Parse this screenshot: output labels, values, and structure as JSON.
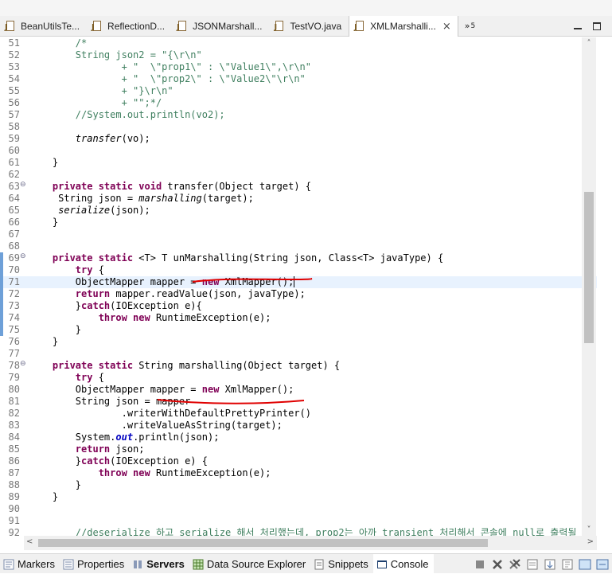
{
  "editor_tabs": [
    {
      "label": "BeanUtilsTe...",
      "icon": "java-file-icon",
      "active": false
    },
    {
      "label": "ReflectionD...",
      "icon": "java-file-icon",
      "active": false
    },
    {
      "label": "JSONMarshall...",
      "icon": "java-file-icon",
      "active": false
    },
    {
      "label": "TestVO.java",
      "icon": "java-file-icon",
      "active": false
    },
    {
      "label": "XMLMarshalli...",
      "icon": "java-file-icon",
      "active": true,
      "close": "×"
    }
  ],
  "overflow_tabs": {
    "symbol": "»",
    "count": "5"
  },
  "code_lines": [
    {
      "n": "51",
      "t": [
        [
          "cmt",
          "        /*"
        ]
      ]
    },
    {
      "n": "52",
      "t": [
        [
          "cmt",
          "        String json2 = \"{\\r\\n\""
        ]
      ]
    },
    {
      "n": "53",
      "t": [
        [
          "cmt",
          "                + \"  \\\"prop1\\\" : \\\"Value1\\\",\\r\\n\""
        ]
      ]
    },
    {
      "n": "54",
      "t": [
        [
          "cmt",
          "                + \"  \\\"prop2\\\" : \\\"Value2\\\"\\r\\n\""
        ]
      ]
    },
    {
      "n": "55",
      "t": [
        [
          "cmt",
          "                + \"}\\r\\n\""
        ]
      ]
    },
    {
      "n": "56",
      "t": [
        [
          "cmt",
          "                + \"\";*/"
        ]
      ]
    },
    {
      "n": "57",
      "t": [
        [
          "cmt",
          "        //System.out.println(vo2);"
        ]
      ]
    },
    {
      "n": "58",
      "t": []
    },
    {
      "n": "59",
      "t": [
        [
          "",
          "        "
        ],
        [
          "ital",
          "transfer"
        ],
        [
          "",
          "(vo);"
        ]
      ]
    },
    {
      "n": "60",
      "t": []
    },
    {
      "n": "61",
      "t": [
        [
          "",
          "    }"
        ]
      ]
    },
    {
      "n": "62",
      "t": []
    },
    {
      "n": "63",
      "fold": true,
      "t": [
        [
          "",
          "    "
        ],
        [
          "kw",
          "private static void"
        ],
        [
          "",
          " transfer(Object target) {"
        ]
      ]
    },
    {
      "n": "64",
      "t": [
        [
          "",
          "     String json = "
        ],
        [
          "ital",
          "marshalling"
        ],
        [
          "",
          "(target);"
        ]
      ]
    },
    {
      "n": "65",
      "t": [
        [
          "",
          "     "
        ],
        [
          "ital",
          "serialize"
        ],
        [
          "",
          "(json);"
        ]
      ]
    },
    {
      "n": "66",
      "t": [
        [
          "",
          "    }"
        ]
      ]
    },
    {
      "n": "67",
      "t": []
    },
    {
      "n": "68",
      "t": []
    },
    {
      "n": "69",
      "fold": true,
      "chg": true,
      "t": [
        [
          "",
          "    "
        ],
        [
          "kw",
          "private static"
        ],
        [
          "",
          " <T> T unMarshalling(String json, Class<T> javaType) {"
        ]
      ]
    },
    {
      "n": "70",
      "chg": true,
      "t": [
        [
          "",
          "        "
        ],
        [
          "kw",
          "try"
        ],
        [
          "",
          " {"
        ]
      ]
    },
    {
      "n": "71",
      "chg": true,
      "current": true,
      "t": [
        [
          "",
          "        ObjectMapper mapper = "
        ],
        [
          "kw",
          "new"
        ],
        [
          "",
          " XmlMapper();"
        ]
      ]
    },
    {
      "n": "72",
      "chg": true,
      "t": [
        [
          "",
          "        "
        ],
        [
          "kw",
          "return"
        ],
        [
          "",
          " mapper.readValue(json, javaType);"
        ]
      ]
    },
    {
      "n": "73",
      "chg": true,
      "t": [
        [
          "",
          "        }"
        ],
        [
          "kw",
          "catch"
        ],
        [
          "",
          "(IOException e){"
        ]
      ]
    },
    {
      "n": "74",
      "chg": true,
      "t": [
        [
          "",
          "            "
        ],
        [
          "kw",
          "throw new"
        ],
        [
          "",
          " RuntimeException(e);"
        ]
      ]
    },
    {
      "n": "75",
      "chg": true,
      "t": [
        [
          "",
          "        }"
        ]
      ]
    },
    {
      "n": "76",
      "t": [
        [
          "",
          "    }"
        ]
      ]
    },
    {
      "n": "77",
      "t": []
    },
    {
      "n": "78",
      "fold": true,
      "t": [
        [
          "",
          "    "
        ],
        [
          "kw",
          "private static"
        ],
        [
          "",
          " String marshalling(Object target) {"
        ]
      ]
    },
    {
      "n": "79",
      "t": [
        [
          "",
          "        "
        ],
        [
          "kw",
          "try"
        ],
        [
          "",
          " {"
        ]
      ]
    },
    {
      "n": "80",
      "t": [
        [
          "",
          "        ObjectMapper mapper = "
        ],
        [
          "kw",
          "new"
        ],
        [
          "",
          " XmlMapper();"
        ]
      ]
    },
    {
      "n": "81",
      "t": [
        [
          "",
          "        String json = mapper"
        ]
      ]
    },
    {
      "n": "82",
      "t": [
        [
          "",
          "                .writerWithDefaultPrettyPrinter()"
        ]
      ]
    },
    {
      "n": "83",
      "t": [
        [
          "",
          "                .writeValueAsString(target);"
        ]
      ]
    },
    {
      "n": "84",
      "t": [
        [
          "",
          "        System."
        ],
        [
          "fld",
          "out"
        ],
        [
          "",
          ".println(json);"
        ]
      ]
    },
    {
      "n": "85",
      "t": [
        [
          "",
          "        "
        ],
        [
          "kw",
          "return"
        ],
        [
          "",
          " json;"
        ]
      ]
    },
    {
      "n": "86",
      "t": [
        [
          "",
          "        }"
        ],
        [
          "kw",
          "catch"
        ],
        [
          "",
          "(IOException e) {"
        ]
      ]
    },
    {
      "n": "87",
      "t": [
        [
          "",
          "            "
        ],
        [
          "kw",
          "throw new"
        ],
        [
          "",
          " RuntimeException(e);"
        ]
      ]
    },
    {
      "n": "88",
      "t": [
        [
          "",
          "        }"
        ]
      ]
    },
    {
      "n": "89",
      "t": [
        [
          "",
          "    }"
        ]
      ]
    },
    {
      "n": "90",
      "t": []
    },
    {
      "n": "91",
      "t": []
    },
    {
      "n": "92",
      "t": [
        [
          "cmt",
          "        //deserialize 하고 serialize 해서 처리했는데, prop2는 아까 transient 처리해서 콘솔에 null로 출력될 것"
        ]
      ]
    }
  ],
  "bottom_tabs": [
    {
      "label": "Markers",
      "icon": "markers-icon",
      "bold": false
    },
    {
      "label": "Properties",
      "icon": "properties-icon",
      "bold": false
    },
    {
      "label": "Servers",
      "icon": "servers-icon",
      "bold": true
    },
    {
      "label": "Data Source Explorer",
      "icon": "data-source-icon",
      "bold": false
    },
    {
      "label": "Snippets",
      "icon": "snippets-icon",
      "bold": false
    },
    {
      "label": "Console",
      "icon": "console-icon",
      "bold": false,
      "active": true
    }
  ],
  "scroll": {
    "vertical_position": 0.31,
    "vertical_visible": 0.3,
    "horizontal_visible": 0.8
  },
  "colors": {
    "keyword": "#7f0055",
    "string": "#2a00ff",
    "comment": "#3f7f5f",
    "current_line": "#e8f2fe",
    "annotation_red": "#e00000"
  }
}
